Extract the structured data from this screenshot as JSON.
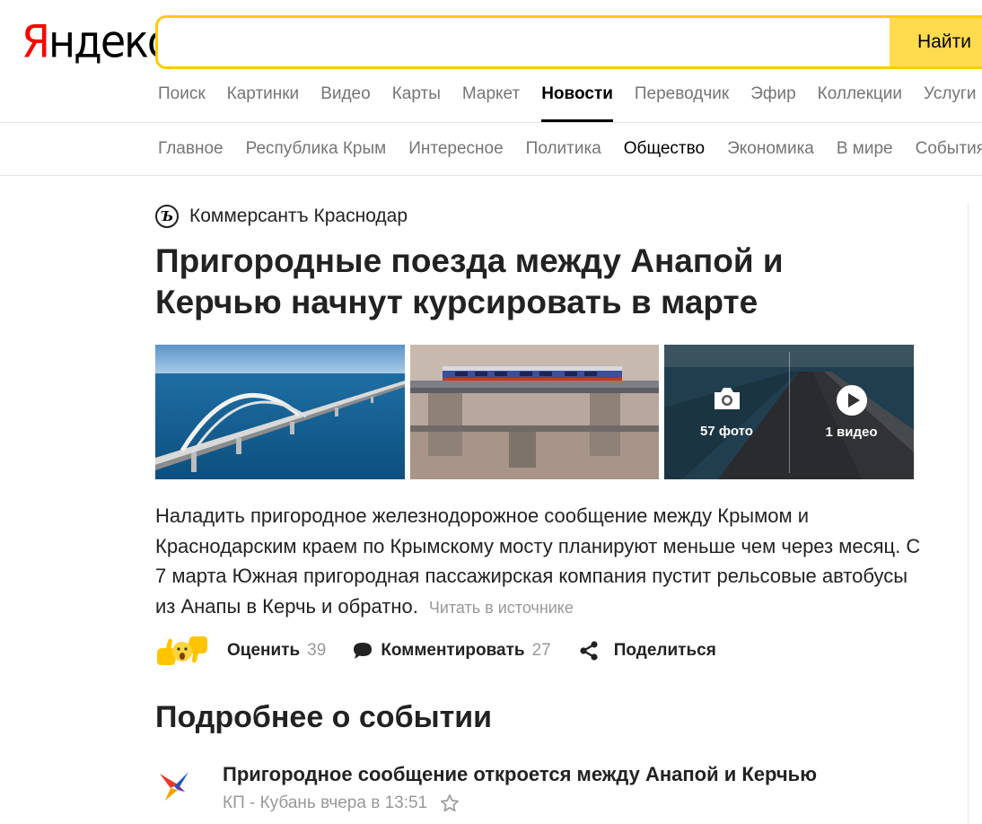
{
  "header": {
    "logo": {
      "first_letter": "Я",
      "rest": "ндекс"
    },
    "search": {
      "value": "",
      "placeholder": "",
      "button": "Найти"
    },
    "services": [
      "Поиск",
      "Картинки",
      "Видео",
      "Карты",
      "Маркет",
      "Новости",
      "Переводчик",
      "Эфир",
      "Коллекции",
      "Услуги"
    ],
    "active_service": "Новости"
  },
  "rubrics": [
    "Главное",
    "Республика Крым",
    "Интересное",
    "Политика",
    "Общество",
    "Экономика",
    "В мире",
    "События"
  ],
  "active_rubric": "Общество",
  "article": {
    "source": "Коммерсантъ Краснодар",
    "source_logo_letter": "Ъ",
    "title": "Пригородные поезда между Анапой и Керчью начнут курсировать в марте",
    "media": {
      "photos": "57 фото",
      "videos": "1 видео"
    },
    "lead": "Наладить пригородное железнодорожное сообщение между Крымом и Краснодарским краем по Крымскому мосту планируют меньше чем через месяц. С 7 марта Южная пригородная пассажирская компания пустит рельсовые автобусы из Анапы в Керчь и обратно.",
    "read_more": "Читать в источнике"
  },
  "actions": {
    "rate": {
      "label": "Оценить",
      "count": "39"
    },
    "comment": {
      "label": "Комментировать",
      "count": "27"
    },
    "share": {
      "label": "Поделиться"
    }
  },
  "details": {
    "title": "Подробнее о событии",
    "items": [
      {
        "title": "Пригородное сообщение откроется между Анапой и Керчью",
        "meta": "КП - Кубань вчера в 13:51"
      }
    ]
  },
  "colors": {
    "accent": "#ffdb4d",
    "search_border": "#ffcc00",
    "logo_red": "#ff0000",
    "muted": "#999999"
  }
}
